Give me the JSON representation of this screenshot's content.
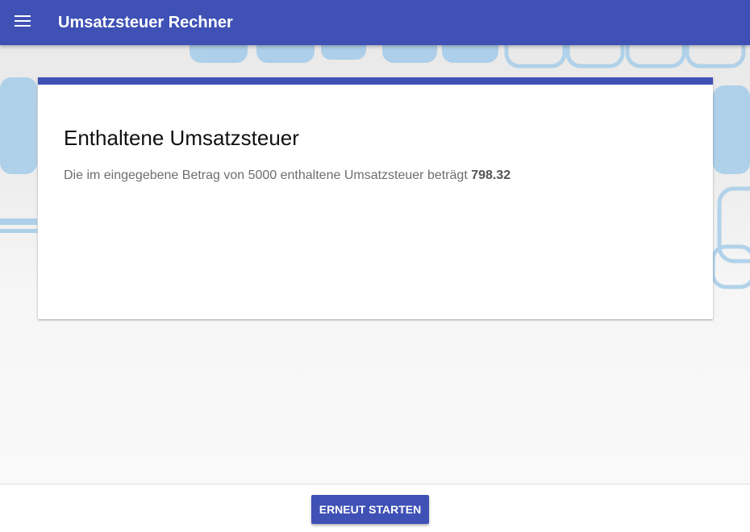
{
  "toolbar": {
    "title": "Umsatzsteuer Rechner",
    "menu_icon": "menu-icon",
    "color": "#3f51b5"
  },
  "result_card": {
    "title": "Enthaltene Umsatzsteuer",
    "text_prefix": "Die im eingegebene Betrag von 5000 enthaltene Umsatzsteuer beträgt ",
    "amount": "798.32"
  },
  "footer": {
    "restart_label": "ERNEUT STARTEN"
  },
  "colors": {
    "primary": "#3f51b5",
    "background_deco": "#9cc6e6"
  }
}
